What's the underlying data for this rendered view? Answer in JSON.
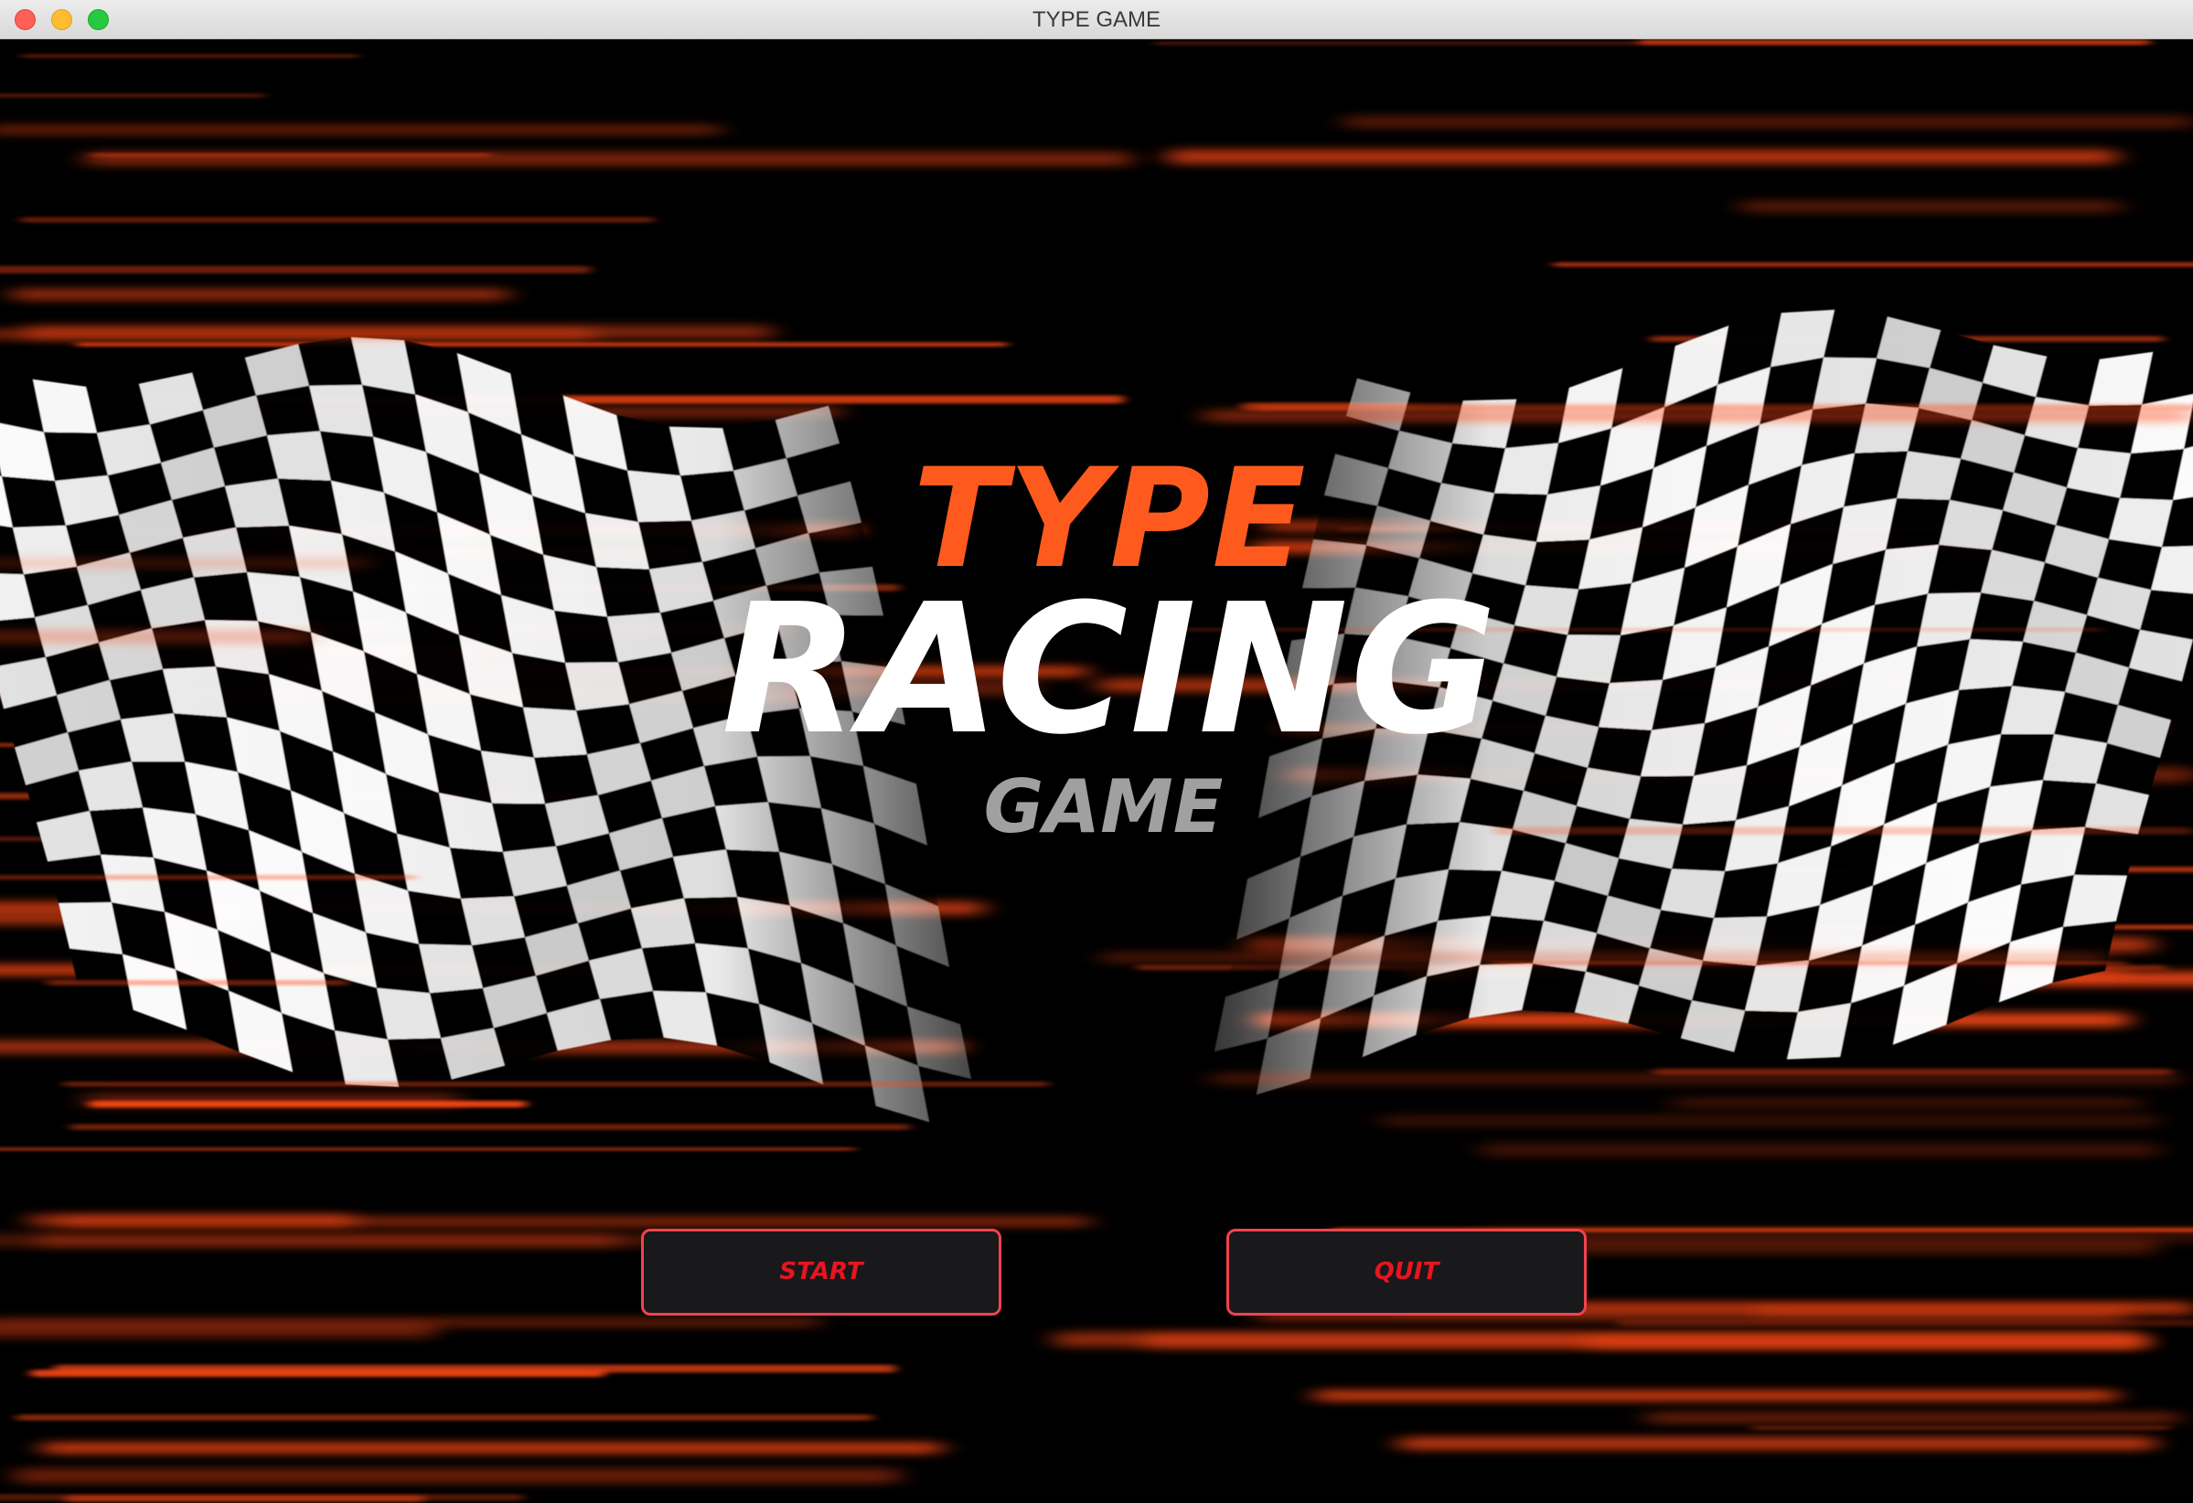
{
  "window": {
    "title": "TYPE GAME"
  },
  "logo": {
    "line1": "TYPE",
    "line2": "RACING",
    "line3": "GAME"
  },
  "buttons": {
    "start_label": "START",
    "quit_label": "QUIT"
  },
  "colors": {
    "title_type": "#fe5a1d",
    "title_racing": "#ffffff",
    "title_game": "#a0a0a0",
    "button_text": "#e8141f",
    "button_border": "#f0434f",
    "button_bg": "#19181a",
    "streak": "#ff4a12",
    "background": "#000000"
  },
  "icons": {
    "close": "close-icon",
    "minimize": "minimize-icon",
    "zoom": "zoom-icon",
    "left_flag": "checkered-flag-icon",
    "right_flag": "checkered-flag-icon"
  }
}
